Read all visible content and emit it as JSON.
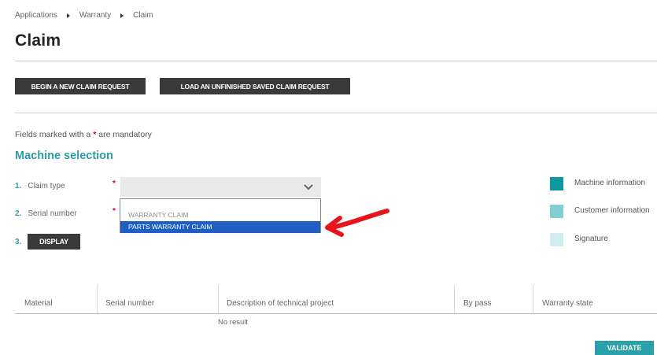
{
  "breadcrumb": {
    "items": [
      "Applications",
      "Warranty",
      "Claim"
    ]
  },
  "page": {
    "title": "Claim"
  },
  "actions": {
    "new_claim": "BEGIN A NEW CLAIM REQUEST",
    "load_saved": "LOAD AN UNFINISHED SAVED CLAIM REQUEST"
  },
  "mandatory_note": {
    "prefix": "Fields marked with a",
    "star": "*",
    "suffix": "are mandatory"
  },
  "section": {
    "title": "Machine selection"
  },
  "steps": [
    {
      "number": "1.",
      "label": "Claim type"
    },
    {
      "number": "2.",
      "label": "Serial number"
    },
    {
      "number": "3.",
      "button": "DISPLAY"
    }
  ],
  "required_star": "*",
  "claim_type_dropdown": {
    "selected": "",
    "options": [
      "WARRANTY CLAIM",
      "PARTS WARRANTY CLAIM"
    ],
    "highlighted_index": 1
  },
  "legend": [
    {
      "label": "Machine information",
      "color": "#0f97a0"
    },
    {
      "label": "Customer information",
      "color": "#7fcfd4"
    },
    {
      "label": "Signature",
      "color": "#cfecee"
    }
  ],
  "table": {
    "columns": [
      "Material",
      "Serial number",
      "Description of technical project",
      "By pass",
      "Warranty state"
    ],
    "empty_text": "No result"
  },
  "validate_button": "VALIDATE",
  "colors": {
    "accent": "#2e9aa6",
    "dark_button": "#3a3a3a",
    "selection": "#1f5fc4",
    "annotation_arrow": "#e8141c"
  }
}
